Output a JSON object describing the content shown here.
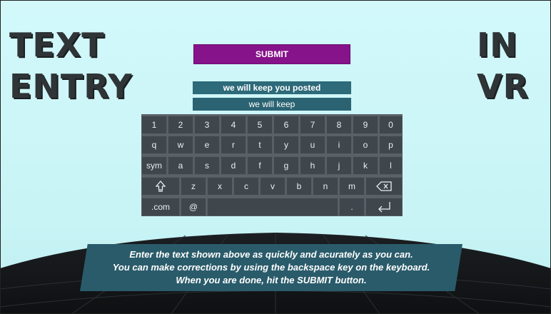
{
  "title_left": {
    "line1": "TEXT",
    "line2": "ENTRY"
  },
  "title_right": {
    "line1": "IN",
    "line2": "VR"
  },
  "submit_label": "SUBMIT",
  "target_phrase": "we will keep you posted",
  "typed_text": "we will keep",
  "keyboard": {
    "row1": [
      "1",
      "2",
      "3",
      "4",
      "5",
      "6",
      "7",
      "8",
      "9",
      "0"
    ],
    "row2": [
      "q",
      "w",
      "e",
      "r",
      "t",
      "y",
      "u",
      "i",
      "o",
      "p"
    ],
    "row3": [
      "sym",
      "a",
      "s",
      "d",
      "f",
      "g",
      "h",
      "j",
      "k",
      "l"
    ],
    "row4": [
      "z",
      "x",
      "c",
      "v",
      "b",
      "n",
      "m"
    ],
    "dotcom": ".com",
    "at": "@",
    "period": ".",
    "icons": {
      "shift": "shift-icon",
      "backspace": "backspace-icon",
      "enter": "enter-icon"
    }
  },
  "instructions": [
    "Enter the text shown above as quickly and acurately as you can.",
    "You can make corrections by using the backspace key on the keyboard.",
    "When you are done, hit the SUBMIT button."
  ],
  "colors": {
    "submit": "#86138a",
    "phrase_bg": "#2d6a7a",
    "key_bg": "#3f464c",
    "sky": "#cdf6f8",
    "instructions_bg": "#2a5b6a"
  }
}
